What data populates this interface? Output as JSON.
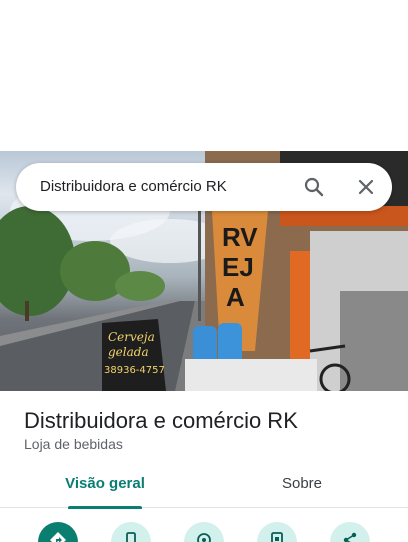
{
  "search": {
    "query": "Distribuidora e comércio RK",
    "icons": [
      "search-icon",
      "close-icon"
    ]
  },
  "place": {
    "name": "Distribuidora e comércio RK",
    "category": "Loja de bebidas"
  },
  "tabs": [
    {
      "label": "Visão geral",
      "active": true
    },
    {
      "label": "Sobre",
      "active": false
    }
  ],
  "actions": [
    {
      "icon": "directions-icon",
      "primary": true
    },
    {
      "icon": "phone-icon",
      "primary": false
    },
    {
      "icon": "location-icon",
      "primary": false
    },
    {
      "icon": "save-icon",
      "primary": false
    },
    {
      "icon": "share-icon",
      "primary": false
    }
  ],
  "colors": {
    "accent": "#0b7e72",
    "action_bg": "#d2f0ec",
    "text_primary": "#202124",
    "text_secondary": "#5f6368"
  }
}
